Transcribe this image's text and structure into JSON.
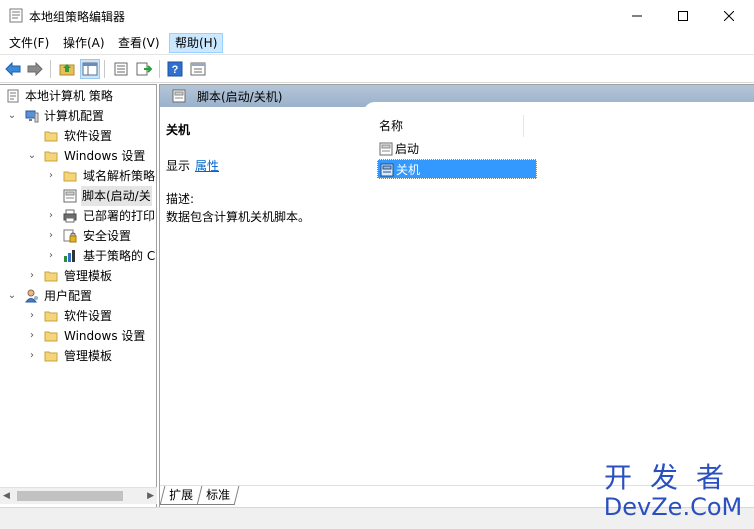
{
  "window": {
    "title": "本地组策略编辑器",
    "controls": {
      "minimize": "minimize-icon",
      "maximize": "maximize-icon",
      "close": "close-icon"
    }
  },
  "menu": {
    "items": [
      {
        "label": "文件(F)"
      },
      {
        "label": "操作(A)"
      },
      {
        "label": "查看(V)"
      },
      {
        "label": "帮助(H)"
      }
    ]
  },
  "toolbar": {
    "buttons": [
      "back-icon",
      "forward-icon",
      "up-folder-icon",
      "show-hide-tree-icon",
      "properties-icon",
      "export-list-icon",
      "help-icon",
      "console-view-icon"
    ]
  },
  "tree": {
    "root": "本地计算机 策略",
    "computer_config": "计算机配置",
    "software_settings": "软件设置",
    "windows_settings": "Windows 设置",
    "name_resolution": "域名解析策略",
    "scripts": "脚本(启动/关",
    "deployed_printers": "已部署的打印",
    "security_settings": "安全设置",
    "policy_qos": "基于策略的 C",
    "admin_templates": "管理模板",
    "user_config": "用户配置",
    "user_software": "软件设置",
    "user_windows": "Windows 设置",
    "user_admin": "管理模板"
  },
  "detail": {
    "header": "脚本(启动/关机)",
    "ext_title": "关机",
    "show_label": "显示",
    "properties_link": "属性",
    "desc_heading": "描述:",
    "desc_text": "数据包含计算机关机脚本。",
    "column_name": "名称",
    "items": [
      {
        "label": "启动"
      },
      {
        "label": "关机"
      }
    ]
  },
  "tabs": {
    "extended": "扩展",
    "standard": "标准"
  },
  "watermark": {
    "cn": "开发者",
    "en": "DevZe.CoM"
  },
  "colors": {
    "header_bar": "#a6bad1",
    "selection": "#3399ff",
    "link": "#0066cc",
    "watermark": "#2a4fbf"
  }
}
